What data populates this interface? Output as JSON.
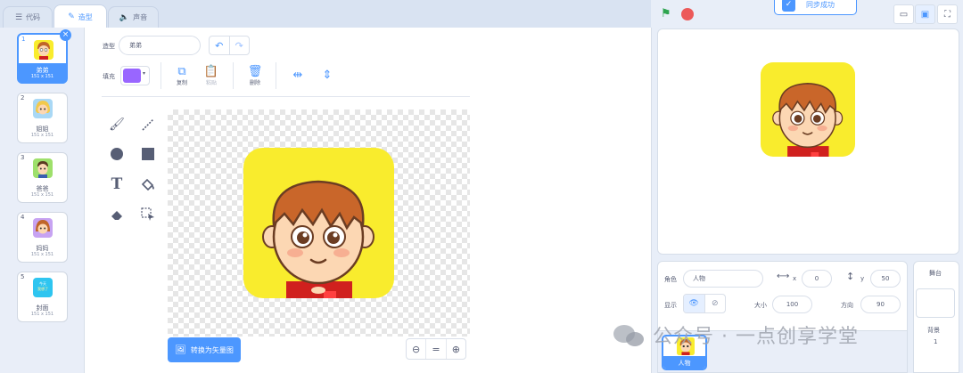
{
  "tabs": [
    {
      "label": "代码",
      "icon": "code-icon"
    },
    {
      "label": "造型",
      "icon": "brush-icon"
    },
    {
      "label": "声音",
      "icon": "speaker-icon"
    }
  ],
  "costumes": [
    {
      "index": "1",
      "name": "弟弟",
      "size": "151 x 151",
      "thumb_color": "#f9ec2d",
      "selected": true
    },
    {
      "index": "2",
      "name": "姐姐",
      "size": "151 x 151",
      "thumb_color": "#a9d8f5"
    },
    {
      "index": "3",
      "name": "爸爸",
      "size": "151 x 151",
      "thumb_color": "#9ee06b"
    },
    {
      "index": "4",
      "name": "妈妈",
      "size": "151 x 151",
      "thumb_color": "#c7a3f2"
    },
    {
      "index": "5",
      "name": "封面",
      "size": "151 x 151",
      "thumb_color": "#2ec5f0",
      "thumb_text": [
        "今天",
        "我想了"
      ]
    }
  ],
  "editor": {
    "costume_label": "造型",
    "costume_name": "弟弟",
    "fill_label": "填充",
    "fill_color": "#9966ff",
    "copy": "复制",
    "paste": "粘贴",
    "delete": "删除",
    "convert_button": "转换为矢量图",
    "zoom_equal": "="
  },
  "stage_header": {
    "sync_text": "同步成功"
  },
  "sprite_info": {
    "sprite_label": "角色",
    "sprite_name": "人物",
    "x_label": "x",
    "x_value": "0",
    "y_label": "y",
    "y_value": "50",
    "show_label": "显示",
    "size_label": "大小",
    "size_value": "100",
    "direction_label": "方向",
    "direction_value": "90"
  },
  "sprite_list": [
    {
      "name": "人物"
    }
  ],
  "stage_pane": {
    "title": "舞台",
    "backdrop_label": "背景",
    "backdrop_count": "1"
  },
  "watermark": "公众号 · 一点创享学堂",
  "colors": {
    "accent": "#4c97ff",
    "art_background": "#f9ec2d",
    "stop": "#ec5959",
    "flag": "#2ea44f"
  }
}
